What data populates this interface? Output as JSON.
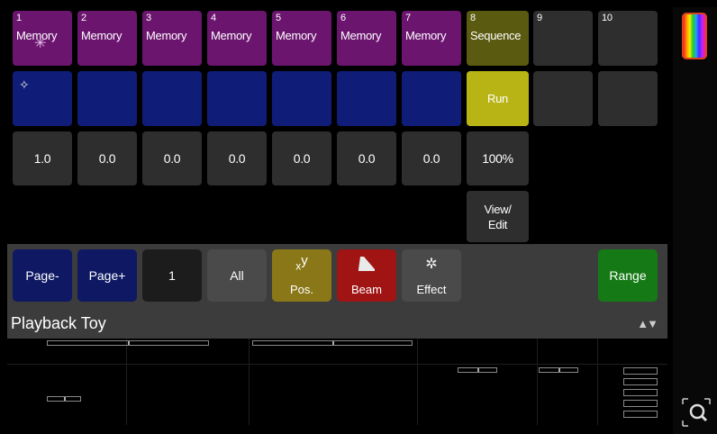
{
  "playback": {
    "title": "Playback Toy",
    "arrows": "▲▼",
    "memories": [
      {
        "num": "1",
        "label": "Memory"
      },
      {
        "num": "2",
        "label": "Memory"
      },
      {
        "num": "3",
        "label": "Memory"
      },
      {
        "num": "4",
        "label": "Memory"
      },
      {
        "num": "5",
        "label": "Memory"
      },
      {
        "num": "6",
        "label": "Memory"
      },
      {
        "num": "7",
        "label": "Memory"
      }
    ],
    "sequence": {
      "num": "8",
      "label": "Sequence"
    },
    "empty_slots": [
      "9",
      "10"
    ],
    "run_label": "Run",
    "values": [
      "1.0",
      "0.0",
      "0.0",
      "0.0",
      "0.0",
      "0.0",
      "0.0"
    ],
    "sequence_value": "100%",
    "view_edit_label": "View/\nEdit"
  },
  "toolbar": {
    "page_minus": "Page-",
    "page_plus": "Page+",
    "page_number": "1",
    "all": "All",
    "pos": "Pos.",
    "beam": "Beam",
    "effect": "Effect",
    "range": "Range"
  },
  "colors": {
    "memory": "#6b156f",
    "sequence": "#5a5a10",
    "blue": "#0f1d78",
    "run": "#b8b416",
    "pos": "#8a7818",
    "beam": "#a01414",
    "range": "#157a15"
  }
}
